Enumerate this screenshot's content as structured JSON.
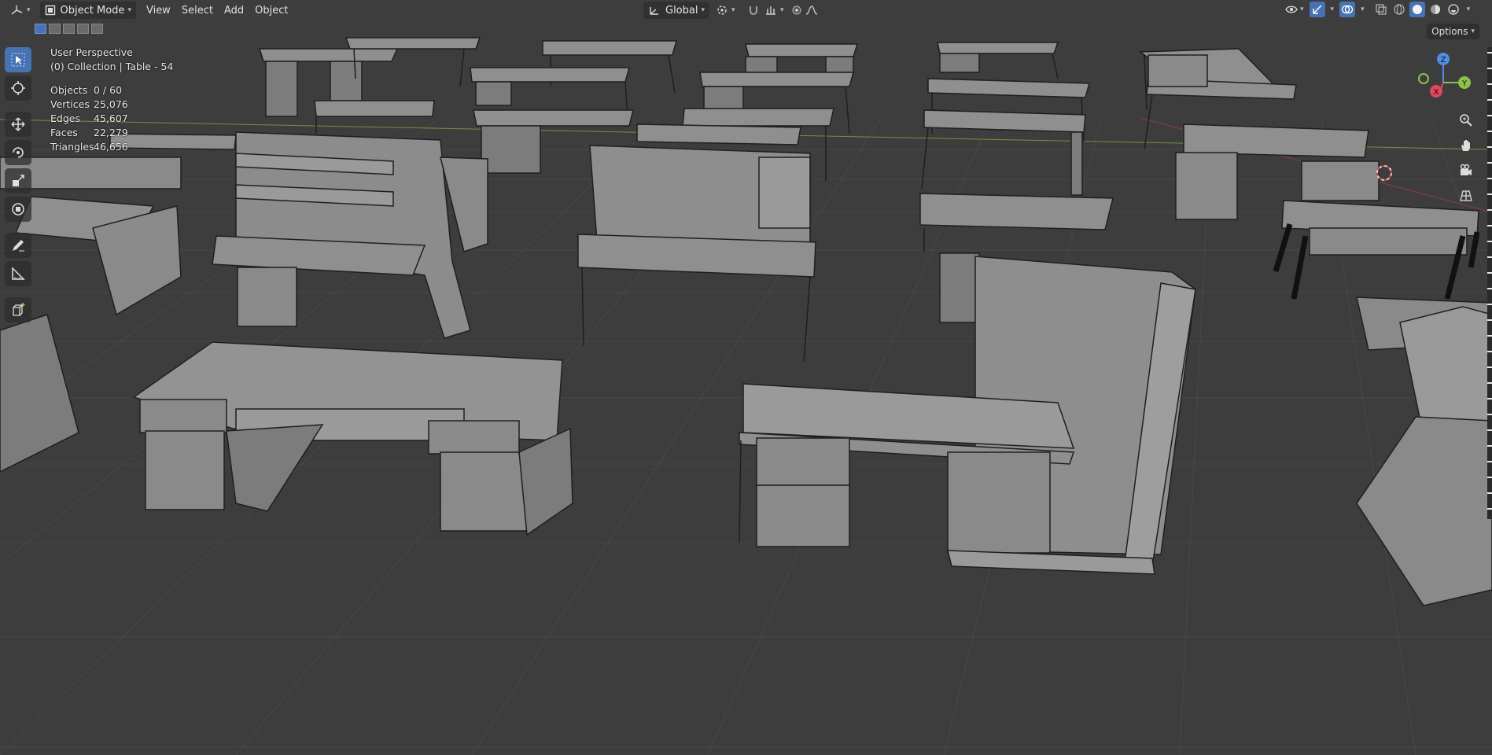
{
  "header": {
    "editor_type_icon": "axis-icon",
    "mode_label": "Object Mode",
    "menus": [
      "View",
      "Select",
      "Add",
      "Object"
    ],
    "orientation_label": "Global",
    "options_label": "Options"
  },
  "overlay": {
    "perspective": "User Perspective",
    "collection": "(0) Collection | Table - 54",
    "stats": [
      {
        "label": "Objects",
        "value": "0 / 60"
      },
      {
        "label": "Vertices",
        "value": "25,076"
      },
      {
        "label": "Edges",
        "value": "45,607"
      },
      {
        "label": "Faces",
        "value": "22,279"
      },
      {
        "label": "Triangles",
        "value": "46,656"
      }
    ]
  },
  "gizmo": {
    "x_label": "X",
    "y_label": "Y",
    "z_label": "Z",
    "x_color": "#e0475c",
    "y_color": "#8bc34a",
    "z_color": "#4f8de2"
  },
  "colors": {
    "background": "#3d3d3d",
    "grid": "#464646",
    "accent": "#4772b3"
  }
}
